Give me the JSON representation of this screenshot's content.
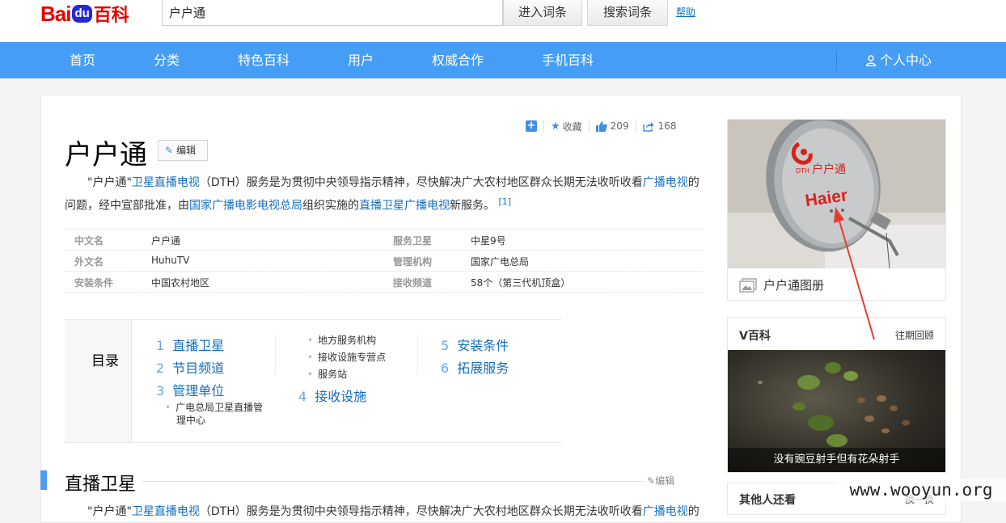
{
  "header": {
    "logo_bai": "Bai",
    "logo_du": "du",
    "logo_baike": "百科",
    "search_value": "户户通",
    "enter_button": "进入词条",
    "search_button": "搜索词条",
    "help_link": "帮助"
  },
  "nav": {
    "items": [
      "首页",
      "分类",
      "特色百科",
      "用户",
      "权威合作",
      "手机百科"
    ],
    "user_center": "个人中心"
  },
  "toolbar": {
    "collect": "收藏",
    "like_count": "209",
    "share_count": "168"
  },
  "entry": {
    "title": "户户通",
    "edit_label": "编辑",
    "summary": {
      "t1": "\"户户通\"",
      "l1": "卫星直播电视",
      "t2": "（DTH）服务是为贯彻中央领导指示精神，尽快解决广大农村地区群众长期无法收听收看",
      "l2": "广播电视",
      "t3": "的问题，经中宣部批准，由",
      "l3": "国家广播电影电视总局",
      "t4": "组织实施的",
      "l4": "直播卫星广播电视",
      "t5": "新服务。",
      "ref": "[1]"
    }
  },
  "basic_info": {
    "left": [
      {
        "k": "中文名",
        "v": "户户通"
      },
      {
        "k": "外文名",
        "v": "HuhuTV"
      },
      {
        "k": "安装条件",
        "v": "中国农村地区"
      }
    ],
    "right": [
      {
        "k": "服务卫星",
        "v": "中星9号"
      },
      {
        "k": "管理机构",
        "v": "国家广电总局"
      },
      {
        "k": "接收频道",
        "v": "58个（第三代机顶盒）"
      }
    ]
  },
  "catalog": {
    "heading": "目录",
    "items": [
      {
        "n": "1",
        "label": "直播卫星"
      },
      {
        "n": "2",
        "label": "节目频道"
      },
      {
        "n": "3",
        "label": "管理单位"
      },
      {
        "n": "4",
        "label": "接收设施"
      },
      {
        "n": "5",
        "label": "安装条件"
      },
      {
        "n": "6",
        "label": "拓展服务"
      }
    ],
    "sub_items": {
      "s3_1": "广电总局卫星直播管理中心",
      "s3_1a": "广电总局卫星直播管",
      "s3_1b": "理中心",
      "s_a": "地方服务机构",
      "s_b": "接收设施专营点",
      "s_c": "服务站"
    }
  },
  "section": {
    "title": "直播卫星",
    "edit_label": "编辑",
    "text_start": "\"户户通\"",
    "text_link": "卫星直播电视",
    "text_rest": "（DTH）服务是为贯彻中央领导指示精神，尽快解决广大农村地区群众长期无法收听收看",
    "text_link2": "广播电视",
    "text_end": "的"
  },
  "side": {
    "album_caption": "户户通图册",
    "dish_brand": "Haier",
    "dish_logo": "户户通",
    "dish_small": "DTH",
    "vbaike_title": "V百科",
    "vbaike_past": "往期回顾",
    "vbaike_caption": "没有豌豆射手但有花朵射手",
    "others_title": "其他人还看",
    "others_more": "换一换"
  },
  "watermark": "www.wooyun.org",
  "colors": {
    "nav_blue": "#459df5",
    "link_blue": "#136ec2",
    "annotation_red": "#e83b2f"
  }
}
